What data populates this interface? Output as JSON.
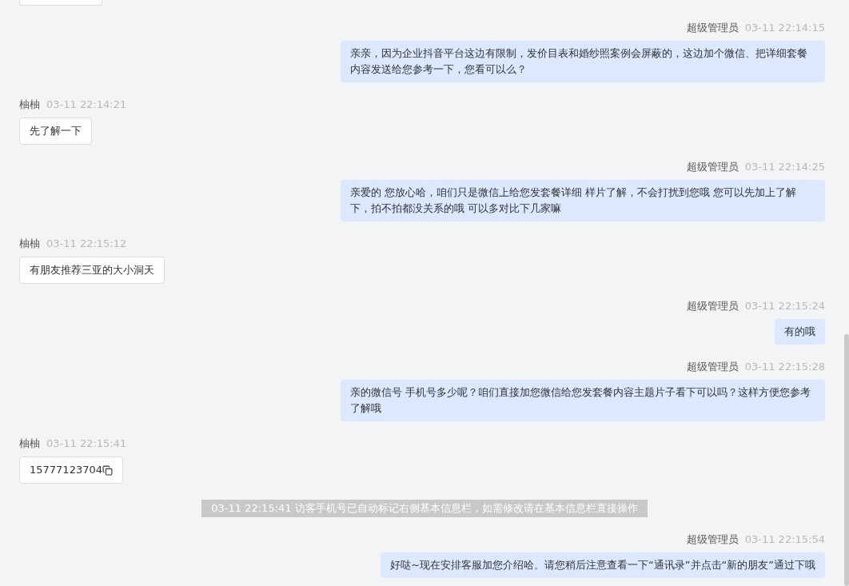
{
  "messages": [
    {
      "kind": "outgoing",
      "sender": "超级管理员",
      "time": "03-11 22:14:15",
      "text": "亲亲，因为企业抖音平台这边有限制，发价目表和婚纱照案例会屏蔽的，这边加个微信、把详细套餐内容发送给您参考一下，您看可以么？"
    },
    {
      "kind": "incoming",
      "sender": "柚柚",
      "time": "03-11 22:14:21",
      "text": "先了解一下"
    },
    {
      "kind": "outgoing",
      "sender": "超级管理员",
      "time": "03-11 22:14:25",
      "text": "亲爱的 您放心哈，咱们只是微信上给您发套餐详细 样片了解，不会打扰到您哦 您可以先加上了解下，拍不拍都没关系的哦 可以多对比下几家嘛"
    },
    {
      "kind": "incoming",
      "sender": "柚柚",
      "time": "03-11 22:15:12",
      "text": "有朋友推荐三亚的大小洞天"
    },
    {
      "kind": "outgoing",
      "sender": "超级管理员",
      "time": "03-11 22:15:24",
      "text": "有的哦"
    },
    {
      "kind": "outgoing",
      "sender": "超级管理员",
      "time": "03-11 22:15:28",
      "text": "亲的微信号 手机号多少呢？咱们直接加您微信给您发套餐内容主题片子看下可以吗？这样方便您参考了解哦"
    },
    {
      "kind": "phone",
      "sender": "柚柚",
      "time": "03-11 22:15:41",
      "text": "15777123704"
    },
    {
      "kind": "system",
      "time": "03-11 22:15:41",
      "text": "访客手机号已自动标记右侧基本信息栏，如需修改请在基本信息栏直接操作"
    },
    {
      "kind": "outgoing",
      "sender": "超级管理员",
      "time": "03-11 22:15:54",
      "text": "好哒~现在安排客服加您介绍哈。请您稍后注意查看一下“通讯录”并点击“新的朋友”通过下哦"
    }
  ]
}
